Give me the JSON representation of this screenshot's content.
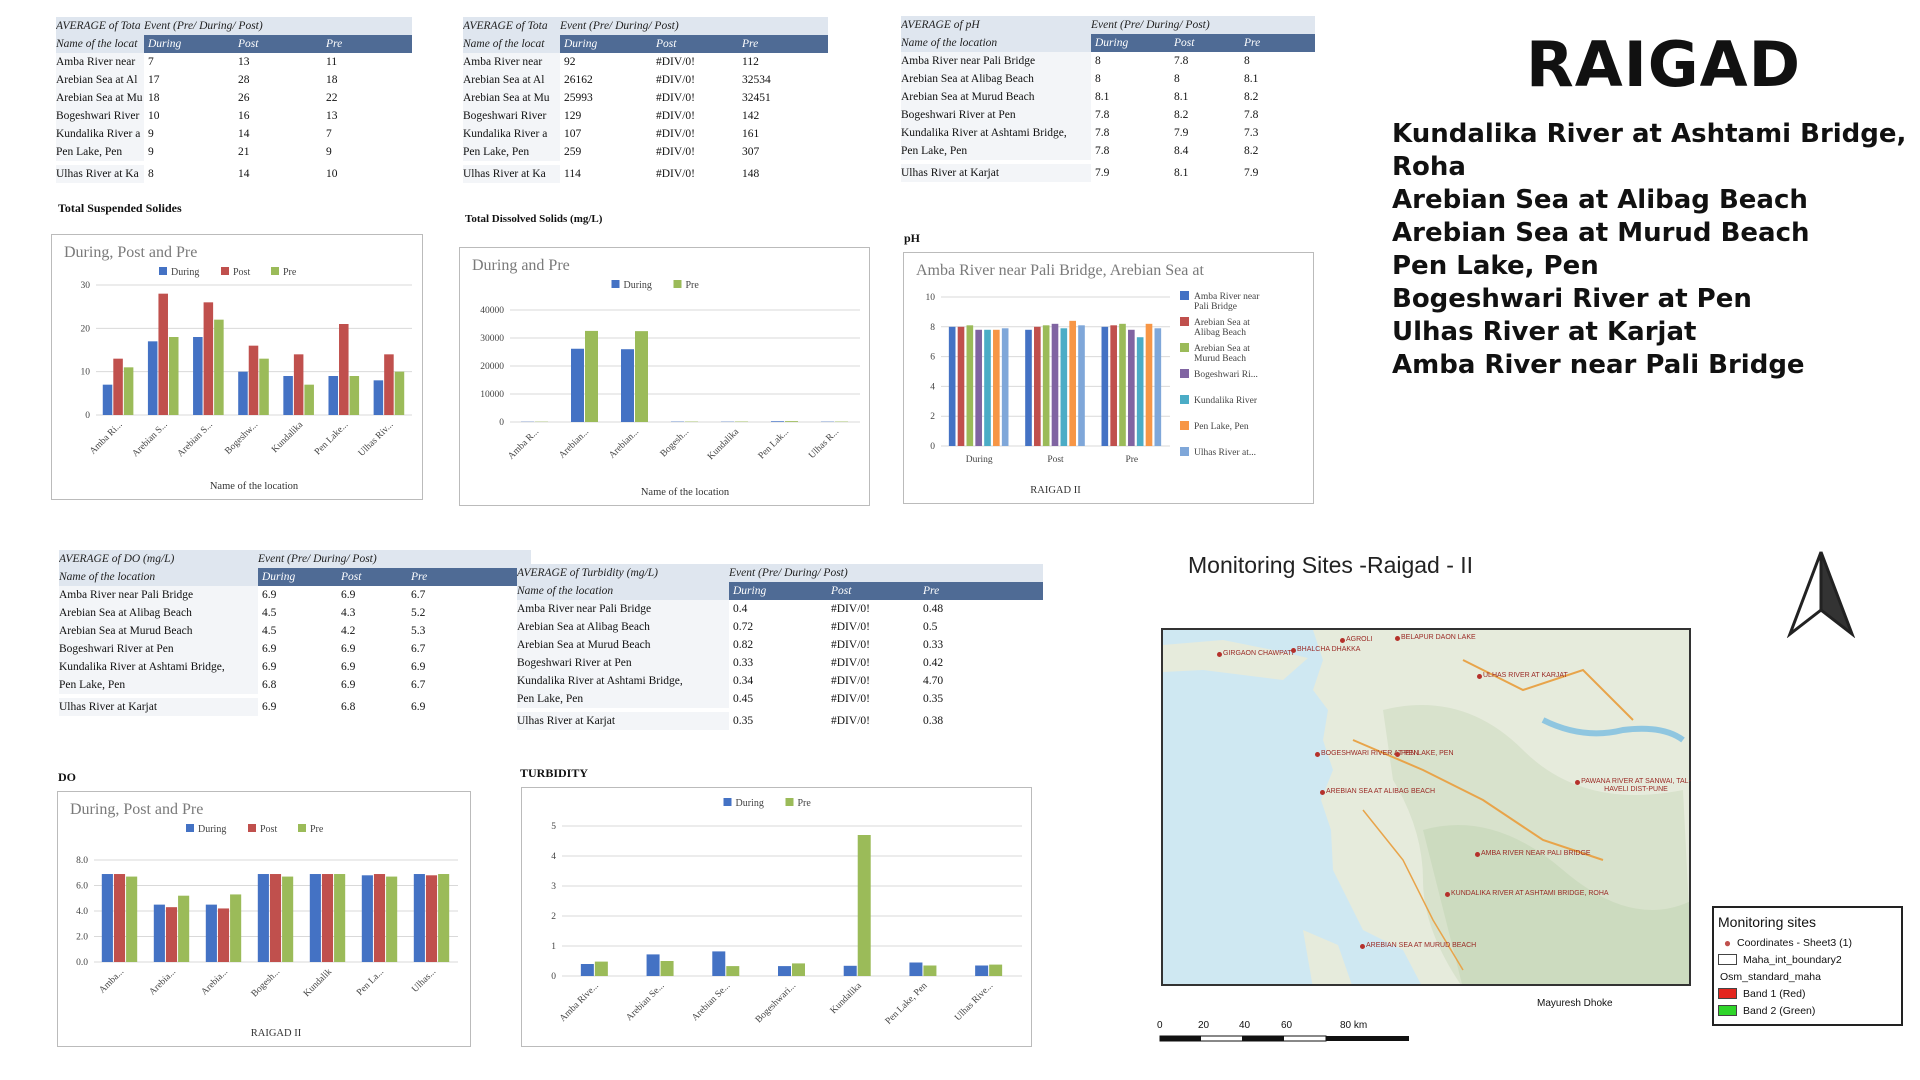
{
  "colors": {
    "during": "#4472c4",
    "post": "#c0504d",
    "pre": "#9bbb59",
    "header": "#4f6b95",
    "map_water": "#cfe8f2",
    "map_land": "#e8ecdf"
  },
  "tables": {
    "tss": {
      "title": "AVERAGE of Tota",
      "event": "Event (Pre/ During/ Post)",
      "loc": "Name of the locat",
      "cols": [
        "During",
        "Post",
        "Pre"
      ],
      "rows": [
        [
          "Amba River near",
          "7",
          "13",
          "11"
        ],
        [
          "Arebian Sea at Al",
          "17",
          "28",
          "18"
        ],
        [
          "Arebian Sea at Mu",
          "18",
          "26",
          "22"
        ],
        [
          "Bogeshwari River",
          "10",
          "16",
          "13"
        ],
        [
          "Kundalika River a",
          "9",
          "14",
          "7"
        ],
        [
          "Pen Lake, Pen",
          "9",
          "21",
          "9"
        ],
        [
          "Ulhas River at Ka",
          "8",
          "14",
          "10"
        ]
      ]
    },
    "tds": {
      "title": "AVERAGE of Tota",
      "event": "Event (Pre/ During/ Post)",
      "loc": "Name of the locat",
      "cols": [
        "During",
        "Post",
        "Pre"
      ],
      "rows": [
        [
          "Amba River near",
          "92",
          "#DIV/0!",
          "112"
        ],
        [
          "Arebian Sea at Al",
          "26162",
          "#DIV/0!",
          "32534"
        ],
        [
          "Arebian Sea at Mu",
          "25993",
          "#DIV/0!",
          "32451"
        ],
        [
          "Bogeshwari River",
          "129",
          "#DIV/0!",
          "142"
        ],
        [
          "Kundalika River a",
          "107",
          "#DIV/0!",
          "161"
        ],
        [
          "Pen Lake, Pen",
          "259",
          "#DIV/0!",
          "307"
        ],
        [
          "Ulhas River at Ka",
          "114",
          "#DIV/0!",
          "148"
        ]
      ]
    },
    "ph": {
      "title": "AVERAGE of pH",
      "event": "Event (Pre/ During/ Post)",
      "loc": "Name of the location",
      "cols": [
        "During",
        "Post",
        "Pre"
      ],
      "rows": [
        [
          "Amba River near Pali Bridge",
          "8",
          "7.8",
          "8"
        ],
        [
          "Arebian Sea at Alibag Beach",
          "8",
          "8",
          "8.1"
        ],
        [
          "Arebian Sea at Murud Beach",
          "8.1",
          "8.1",
          "8.2"
        ],
        [
          "Bogeshwari River at Pen",
          "7.8",
          "8.2",
          "7.8"
        ],
        [
          "Kundalika River at Ashtami Bridge,",
          "7.8",
          "7.9",
          "7.3"
        ],
        [
          "Pen Lake, Pen",
          "7.8",
          "8.4",
          "8.2"
        ],
        [
          "Ulhas River at Karjat",
          "7.9",
          "8.1",
          "7.9"
        ]
      ]
    },
    "do": {
      "title": "AVERAGE of DO (mg/L)",
      "event": "Event (Pre/ During/ Post)",
      "loc": "Name of the location",
      "cols": [
        "During",
        "Post",
        "Pre"
      ],
      "rows": [
        [
          "Amba River near Pali Bridge",
          "6.9",
          "6.9",
          "6.7"
        ],
        [
          "Arebian Sea at Alibag Beach",
          "4.5",
          "4.3",
          "5.2"
        ],
        [
          "Arebian Sea at Murud Beach",
          "4.5",
          "4.2",
          "5.3"
        ],
        [
          "Bogeshwari River at Pen",
          "6.9",
          "6.9",
          "6.7"
        ],
        [
          "Kundalika River at Ashtami Bridge,",
          "6.9",
          "6.9",
          "6.9"
        ],
        [
          "Pen Lake, Pen",
          "6.8",
          "6.9",
          "6.7"
        ],
        [
          "Ulhas River at Karjat",
          "6.9",
          "6.8",
          "6.9"
        ]
      ]
    },
    "turb": {
      "title": "AVERAGE of Turbidity (mg/L)",
      "event": "Event (Pre/ During/ Post)",
      "loc": "Name of the location",
      "cols": [
        "During",
        "Post",
        "Pre"
      ],
      "rows": [
        [
          "Amba River near Pali Bridge",
          "0.4",
          "#DIV/0!",
          "0.48"
        ],
        [
          "Arebian Sea at Alibag Beach",
          "0.72",
          "#DIV/0!",
          "0.5"
        ],
        [
          "Arebian Sea at Murud Beach",
          "0.82",
          "#DIV/0!",
          "0.33"
        ],
        [
          "Bogeshwari River at Pen",
          "0.33",
          "#DIV/0!",
          "0.42"
        ],
        [
          "Kundalika River at Ashtami Bridge,",
          "0.34",
          "#DIV/0!",
          "4.70"
        ],
        [
          "Pen Lake, Pen",
          "0.45",
          "#DIV/0!",
          "0.35"
        ],
        [
          "Ulhas River at Karjat",
          "0.35",
          "#DIV/0!",
          "0.38"
        ]
      ]
    }
  },
  "sections": {
    "tss": "Total Suspended Solides",
    "tds": "Total Dissolved Solids (mg/L)",
    "ph": "pH",
    "do": "DO",
    "turb": "TURBIDITY"
  },
  "chart_data": [
    {
      "id": "tss",
      "type": "bar",
      "title": "During, Post and Pre",
      "xlabel": "Name of the location",
      "ylabel": "",
      "ylim": [
        0,
        30
      ],
      "yticks": [
        "0",
        "10",
        "20",
        "30"
      ],
      "categories": [
        "Amba Ri...",
        "Arebian S...",
        "Arebian S...",
        "Bogeshw...",
        "Kundalika",
        "Pen Lake...",
        "Ulhas Riv..."
      ],
      "series": [
        {
          "name": "During",
          "values": [
            7,
            17,
            18,
            10,
            9,
            9,
            8
          ]
        },
        {
          "name": "Post",
          "values": [
            13,
            28,
            26,
            16,
            14,
            21,
            14
          ]
        },
        {
          "name": "Pre",
          "values": [
            11,
            18,
            22,
            13,
            7,
            9,
            10
          ]
        }
      ]
    },
    {
      "id": "tds",
      "type": "bar",
      "title": "During and Pre",
      "xlabel": "Name of the location",
      "ylabel": "",
      "ylim": [
        0,
        40000
      ],
      "yticks": [
        "0",
        "10000",
        "20000",
        "30000",
        "40000"
      ],
      "categories": [
        "Amba R...",
        "Arebian...",
        "Arebian...",
        "Bogesh...",
        "Kundalika",
        "Pen Lak...",
        "Ulhas R..."
      ],
      "series": [
        {
          "name": "During",
          "values": [
            92,
            26162,
            25993,
            129,
            107,
            259,
            114
          ]
        },
        {
          "name": "Pre",
          "values": [
            112,
            32534,
            32451,
            142,
            161,
            307,
            148
          ]
        }
      ]
    },
    {
      "id": "ph",
      "type": "bar",
      "title": "Amba River near Pali Bridge, Arebian Sea at",
      "xlabel": "RAIGAD II",
      "ylabel": "",
      "ylim": [
        0,
        10
      ],
      "yticks": [
        "0",
        "2",
        "4",
        "6",
        "8",
        "10"
      ],
      "categories": [
        "During",
        "Post",
        "Pre"
      ],
      "series": [
        {
          "name": "Amba River near Pali Bridge",
          "values": [
            8,
            7.8,
            8
          ]
        },
        {
          "name": "Arebian Sea at Alibag Beach",
          "values": [
            8,
            8,
            8.1
          ]
        },
        {
          "name": "Arebian Sea at Murud Beach",
          "values": [
            8.1,
            8.1,
            8.2
          ]
        },
        {
          "name": "Bogeshwari Ri...",
          "values": [
            7.8,
            8.2,
            7.8
          ]
        },
        {
          "name": "Kundalika River",
          "values": [
            7.8,
            7.9,
            7.3
          ]
        },
        {
          "name": "Pen Lake, Pen",
          "values": [
            7.8,
            8.4,
            8.2
          ]
        },
        {
          "name": "Ulhas River at...",
          "values": [
            7.9,
            8.1,
            7.9
          ]
        }
      ]
    },
    {
      "id": "do",
      "type": "bar",
      "title": "During, Post and Pre",
      "xlabel": "RAIGAD II",
      "ylabel": "",
      "ylim": [
        0,
        8
      ],
      "yticks": [
        "0.0",
        "2.0",
        "4.0",
        "6.0",
        "8.0"
      ],
      "categories": [
        "Amba...",
        "Arebia...",
        "Arebia...",
        "Bogesh...",
        "Kundalik",
        "Pen La...",
        "Ulhas..."
      ],
      "series": [
        {
          "name": "During",
          "values": [
            6.9,
            4.5,
            4.5,
            6.9,
            6.9,
            6.8,
            6.9
          ]
        },
        {
          "name": "Post",
          "values": [
            6.9,
            4.3,
            4.2,
            6.9,
            6.9,
            6.9,
            6.8
          ]
        },
        {
          "name": "Pre",
          "values": [
            6.7,
            5.2,
            5.3,
            6.7,
            6.9,
            6.7,
            6.9
          ]
        }
      ]
    },
    {
      "id": "turb",
      "type": "bar",
      "title": "",
      "xlabel": "",
      "ylabel": "",
      "ylim": [
        0,
        5
      ],
      "yticks": [
        "0",
        "1",
        "2",
        "3",
        "4",
        "5"
      ],
      "categories": [
        "Amba Rive...",
        "Arebian Se...",
        "Arebian Se...",
        "Bogeshwari...",
        "Kundalika",
        "Pen Lake, Pen",
        "Ulhas Rive..."
      ],
      "series": [
        {
          "name": "During",
          "values": [
            0.4,
            0.72,
            0.82,
            0.33,
            0.34,
            0.45,
            0.35
          ]
        },
        {
          "name": "Pre",
          "values": [
            0.48,
            0.5,
            0.33,
            0.42,
            4.7,
            0.35,
            0.38
          ]
        }
      ]
    }
  ],
  "region": "RAIGAD",
  "sites": [
    "Kundalika River at Ashtami Bridge,",
    "Roha",
    "Arebian Sea at Alibag Beach",
    "Arebian Sea at Murud Beach",
    "Pen Lake, Pen",
    "Bogeshwari River at Pen",
    "Ulhas River at Karjat",
    "Amba River near Pali Bridge"
  ],
  "map": {
    "title": "Monitoring Sites -Raigad - II",
    "author": "Mayuresh Dhoke",
    "labels": [
      "AGROLI",
      "BELAPUR DAON LAKE",
      "GIRGAON CHAWPATI",
      "BHALCHA DHAKKA",
      "ULHAS RIVER AT KARJAT",
      "BOGESHWARI RIVER AT PEN",
      "PEN LAKE, PEN",
      "PAWANA RIVER AT SANWAI, TAL-HAVELI DIST-PUNE",
      "AREBIAN SEA AT ALIBAG BEACH",
      "AMBA RIVER NEAR PALI BRIDGE",
      "KUNDALIKA RIVER AT ASHTAMI BRIDGE, ROHA",
      "AREBIAN SEA AT MURUD BEACH"
    ],
    "scale": [
      "0",
      "20",
      "40",
      "60",
      "80 km"
    ],
    "legend": {
      "title": "Monitoring sites",
      "items": [
        "Coordinates - Sheet3 (1)",
        "Maha_int_boundary2",
        "Osm_standard_maha",
        "Band 1 (Red)",
        "Band 2 (Green)"
      ]
    }
  }
}
